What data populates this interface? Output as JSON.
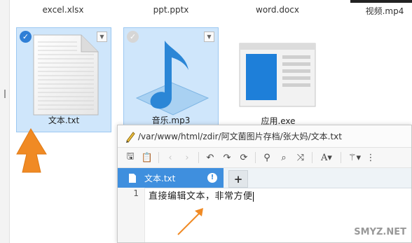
{
  "files_top_row": [
    "excel.xlsx",
    "ppt.pptx",
    "word.docx",
    "视频.mp4"
  ],
  "files": [
    {
      "name": "文本.txt",
      "selected": true
    },
    {
      "name": "音乐.mp3",
      "selected": true
    },
    {
      "name": "应用.exe",
      "selected": false
    }
  ],
  "editor": {
    "path": "/var/www/html/zdir/阿文菌图片存档/张大妈/文本.txt",
    "tab_label": "文本.txt",
    "add_tab": "+",
    "line_number": "1",
    "content": "直接编辑文本，非常方便"
  },
  "watermark": "SMYZ.NET",
  "colors": {
    "accent": "#3f8fde",
    "arrow": "#f08a24",
    "selection": "#cfe6fb"
  }
}
